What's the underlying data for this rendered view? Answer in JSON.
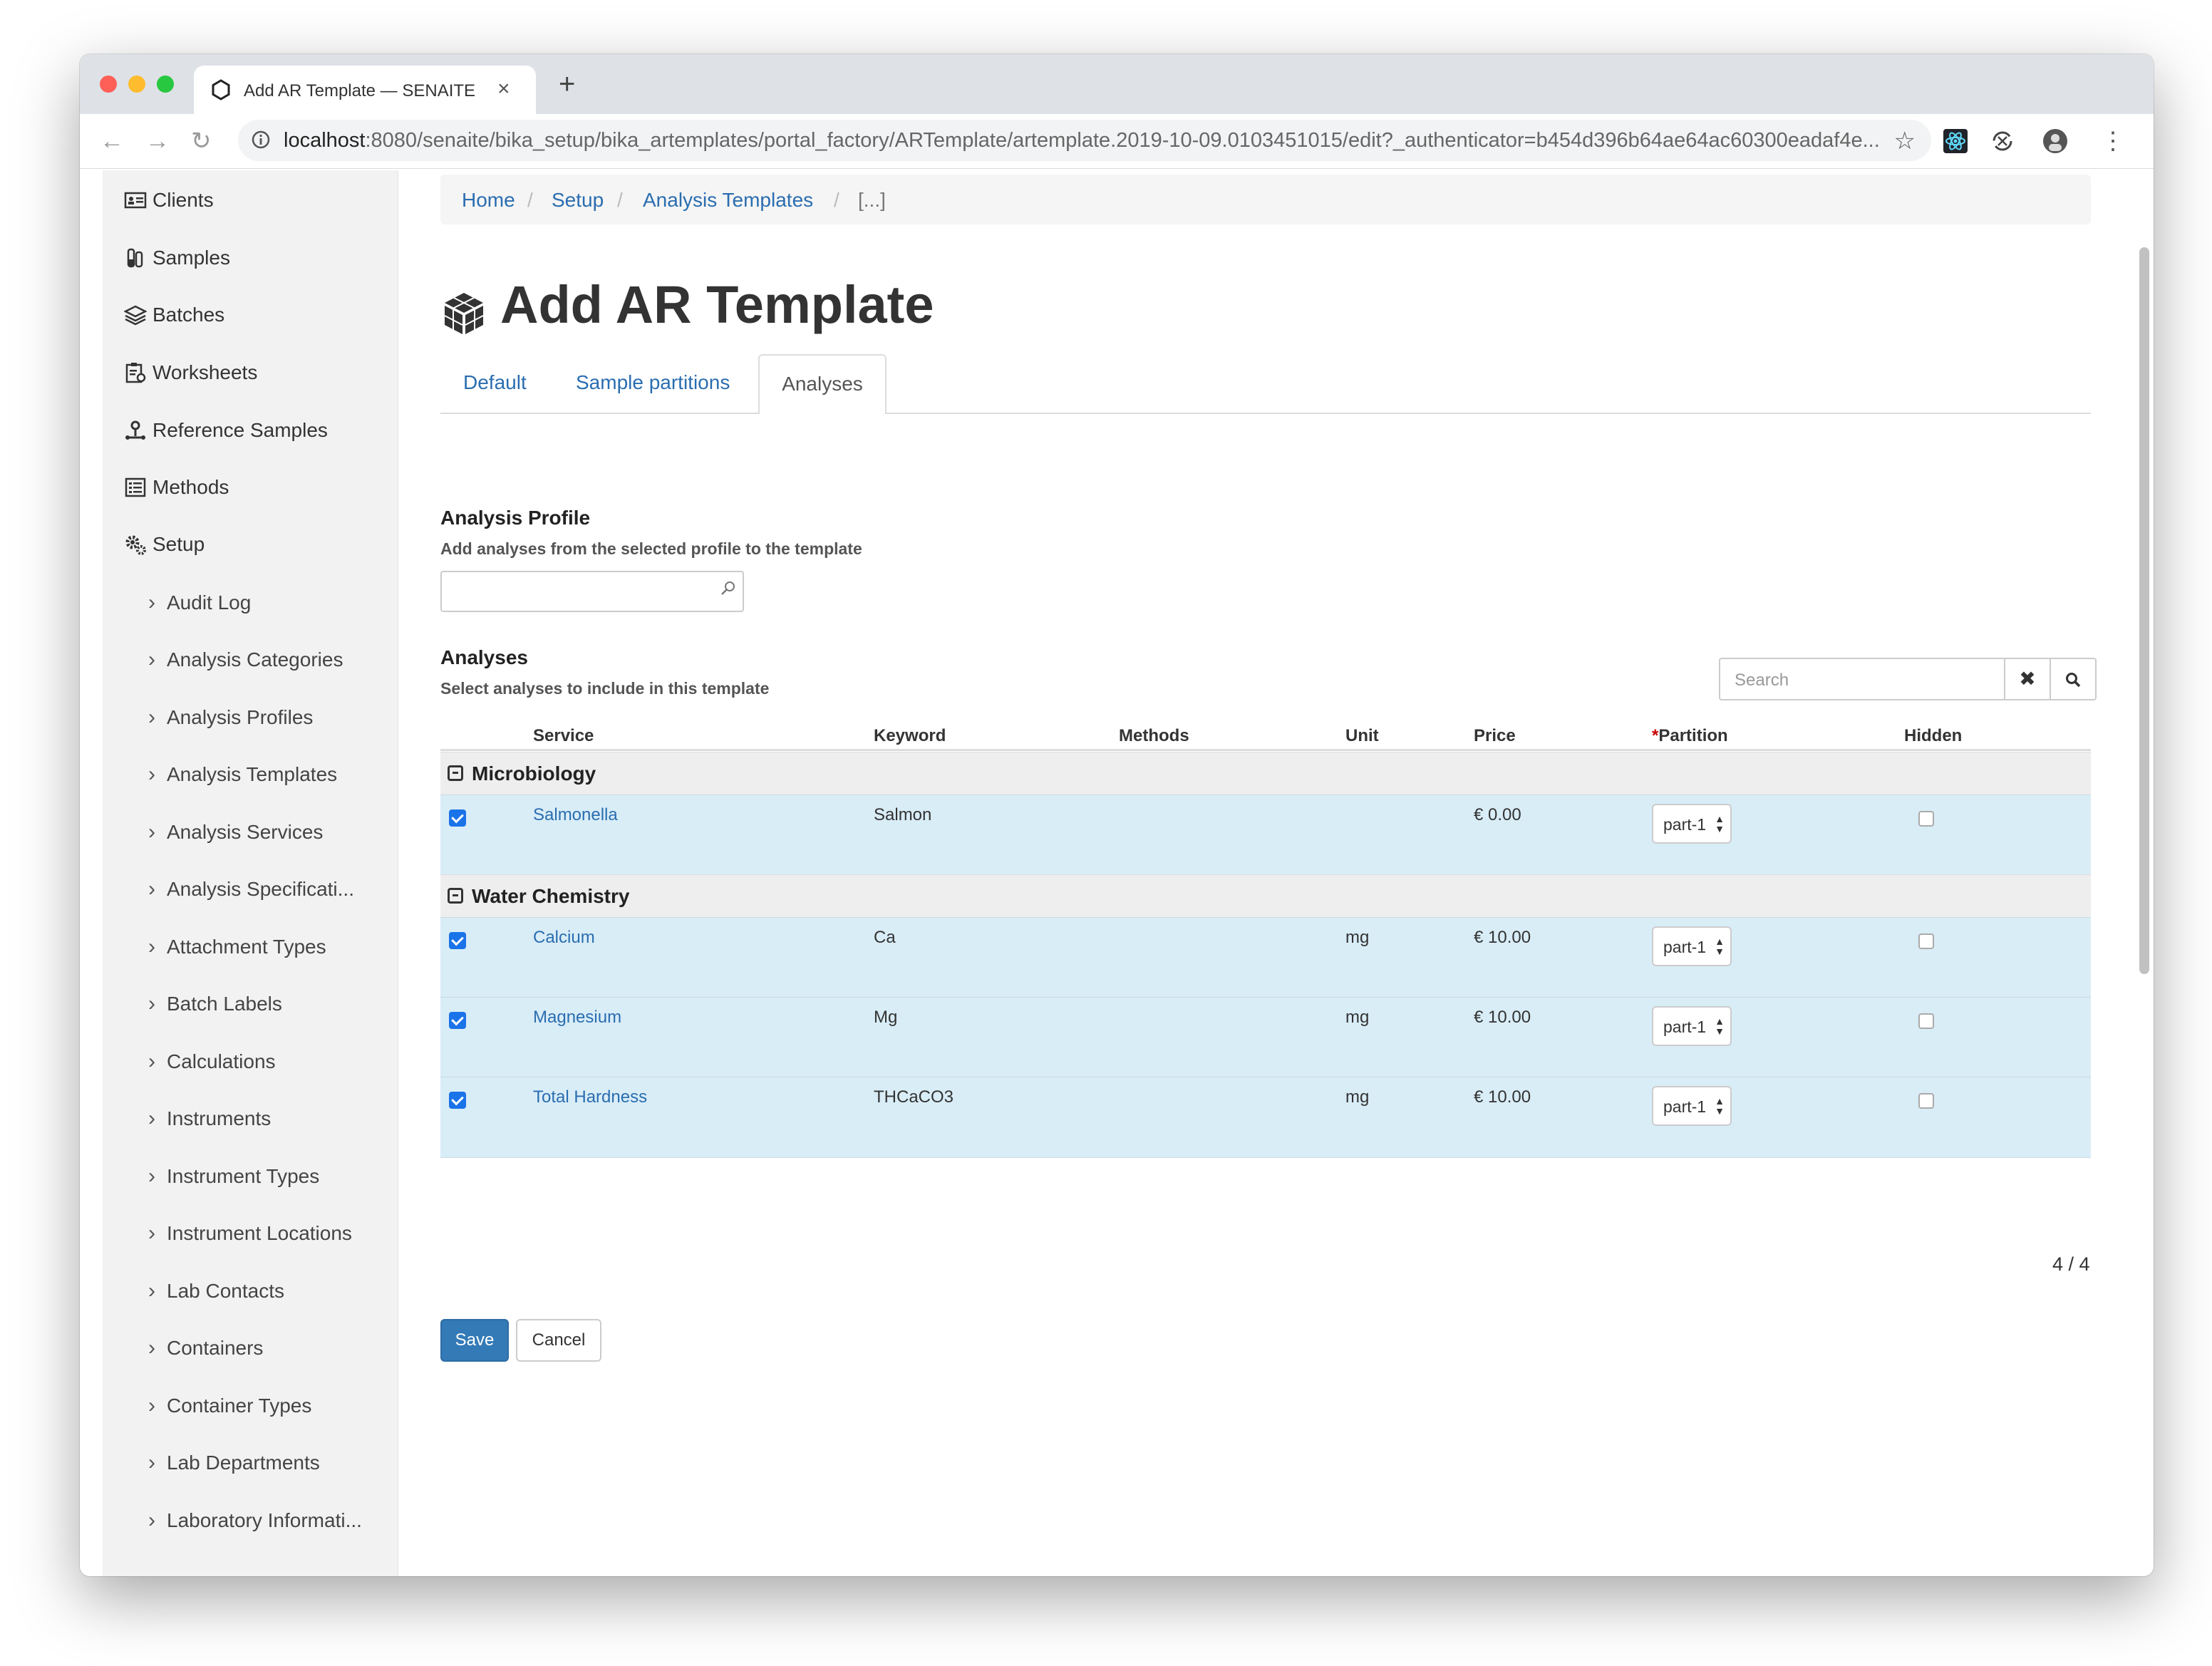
{
  "browser": {
    "tab_title": "Add AR Template — SENAITE",
    "close_label": "×",
    "new_tab_label": "+",
    "url_host": "localhost",
    "url_rest": ":8080/senaite/bika_setup/bika_artemplates/portal_factory/ARTemplate/artemplate.2019-10-09.0103451015/edit?_authenticator=b454d396b64ae64ac60300eadaf4e...",
    "back_label": "←",
    "forward_label": "→",
    "reload_label": "↻",
    "star_label": "☆",
    "menu_label": "⋮"
  },
  "sidebar": {
    "items": [
      {
        "label": "Clients",
        "icon": "clients-icon"
      },
      {
        "label": "Samples",
        "icon": "samples-icon"
      },
      {
        "label": "Batches",
        "icon": "batches-icon"
      },
      {
        "label": "Worksheets",
        "icon": "worksheets-icon"
      },
      {
        "label": "Reference Samples",
        "icon": "reference-samples-icon"
      },
      {
        "label": "Methods",
        "icon": "methods-icon"
      },
      {
        "label": "Setup",
        "icon": "setup-gears-icon"
      }
    ],
    "setup_items": [
      "Audit Log",
      "Analysis Categories",
      "Analysis Profiles",
      "Analysis Templates",
      "Analysis Services",
      "Analysis Specificati...",
      "Attachment Types",
      "Batch Labels",
      "Calculations",
      "Instruments",
      "Instrument Types",
      "Instrument Locations",
      "Lab Contacts",
      "Containers",
      "Container Types",
      "Lab Departments",
      "Laboratory Informati..."
    ]
  },
  "breadcrumb": [
    "Home",
    "Setup",
    "Analysis Templates",
    "[...]"
  ],
  "breadcrumb_separator": "/",
  "page_title": "Add AR Template",
  "tabs": [
    "Default",
    "Sample partitions",
    "Analyses"
  ],
  "active_tab": "Analyses",
  "profile_section": {
    "title": "Analysis Profile",
    "subtitle": "Add analyses from the selected profile to the template",
    "value": ""
  },
  "analyses_section": {
    "title": "Analyses",
    "subtitle": "Select analyses to include in this template"
  },
  "search": {
    "placeholder": "Search",
    "clear_label": "✖"
  },
  "table": {
    "columns": {
      "service": "Service",
      "keyword": "Keyword",
      "methods": "Methods",
      "unit": "Unit",
      "price": "Price",
      "partition_required": "*",
      "partition": "Partition",
      "hidden": "Hidden"
    },
    "categories": [
      {
        "name": "Microbiology",
        "rows": [
          {
            "service": "Salmonella",
            "keyword": "Salmon",
            "methods": "",
            "unit": "",
            "price": "€ 0.00",
            "partition": "part-1",
            "selected": true,
            "hidden": false
          }
        ]
      },
      {
        "name": "Water Chemistry",
        "rows": [
          {
            "service": "Calcium",
            "keyword": "Ca",
            "methods": "",
            "unit": "mg",
            "price": "€ 10.00",
            "partition": "part-1",
            "selected": true,
            "hidden": false
          },
          {
            "service": "Magnesium",
            "keyword": "Mg",
            "methods": "",
            "unit": "mg",
            "price": "€ 10.00",
            "partition": "part-1",
            "selected": true,
            "hidden": false
          },
          {
            "service": "Total Hardness",
            "keyword": "THCaCO3",
            "methods": "",
            "unit": "mg",
            "price": "€ 10.00",
            "partition": "part-1",
            "selected": true,
            "hidden": false
          }
        ]
      }
    ],
    "pager": "4 / 4"
  },
  "buttons": {
    "save": "Save",
    "cancel": "Cancel"
  },
  "colors": {
    "link": "#2a6db0",
    "primary_button": "#337ab7",
    "selected_row": "#d9edf7",
    "category_row": "#eeeeee",
    "sidebar": "#f2f2f2"
  }
}
